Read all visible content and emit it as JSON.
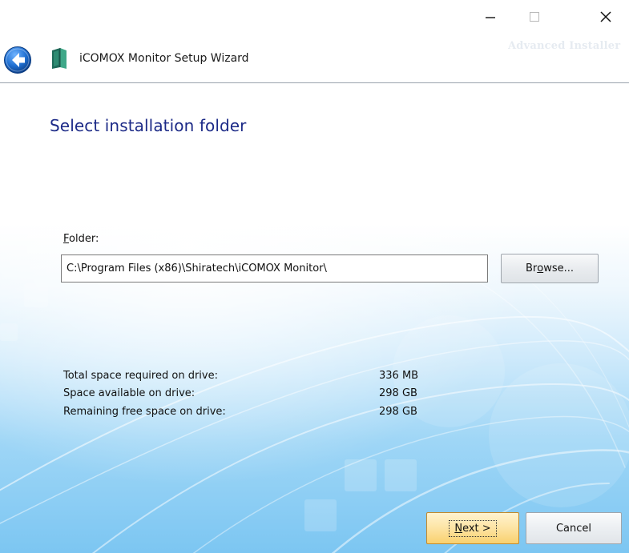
{
  "window": {
    "title": "iCOMOX Monitor Setup Wizard",
    "watermark": "Advanced Installer",
    "controls": {
      "minimize": "minimize-icon",
      "maximize": "maximize-icon",
      "close": "close-icon"
    }
  },
  "header": {
    "back_icon": "back-arrow-icon",
    "app_icon": "installer-book-icon"
  },
  "page": {
    "heading": "Select installation folder",
    "folder_label_first": "F",
    "folder_label_rest": "older:",
    "folder_value": "C:\\Program Files (x86)\\Shiratech\\iCOMOX Monitor\\",
    "browse_pre": "Br",
    "browse_ul": "o",
    "browse_post": "wse...",
    "space": [
      {
        "label": "Total space required on drive:",
        "value": "336 MB"
      },
      {
        "label": "Space available on drive:",
        "value": "298 GB"
      },
      {
        "label": "Remaining free space on drive:",
        "value": "298 GB"
      }
    ]
  },
  "footer": {
    "next_ul": "N",
    "next_rest": "ext >",
    "cancel": "Cancel"
  },
  "colors": {
    "heading": "#1c2a87",
    "next_button": "#f9d16e",
    "background_blue": "#7cc6f2",
    "back_button": "#1f6fd1"
  }
}
